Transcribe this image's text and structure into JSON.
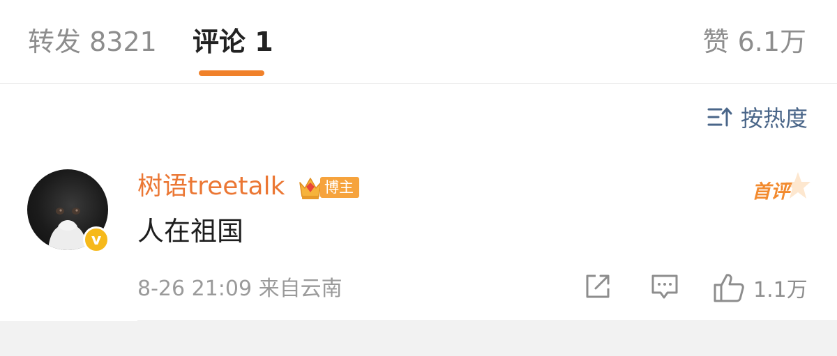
{
  "tabs": {
    "repost": {
      "label": "转发",
      "count": "8321"
    },
    "comment": {
      "label": "评论",
      "count": "1"
    },
    "like": {
      "label": "赞",
      "count": "6.1万"
    }
  },
  "sort": {
    "label": "按热度",
    "icon": "sort-icon"
  },
  "comment": {
    "username": "树语treetalk",
    "author_tag": "博主",
    "first_comment_badge": "首评",
    "verified_icon": "v",
    "text": "人在祖国",
    "time": "8-26 21:09",
    "location": "来自云南",
    "like_count": "1.1万"
  },
  "colors": {
    "accent": "#f0812a",
    "username": "#eb7734",
    "sort": "#4a6689",
    "verified": "#f6b91a",
    "footer": "#f2f2f2"
  }
}
